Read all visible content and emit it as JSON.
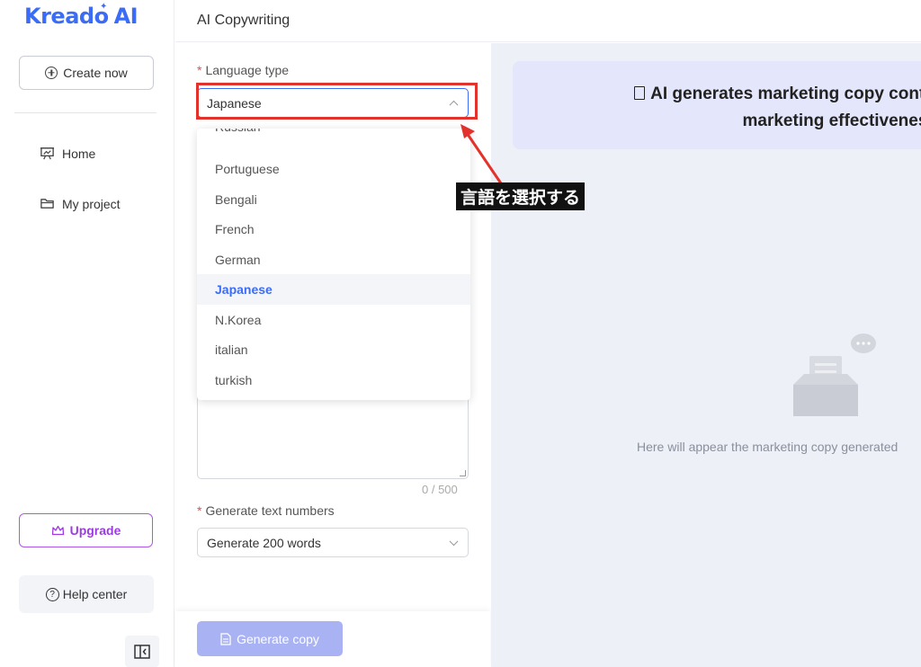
{
  "sidebar": {
    "logo_text": "Kreado",
    "logo_ai": "AI",
    "create_label": "Create now",
    "nav": [
      {
        "label": "Home",
        "icon": "presentation-icon"
      },
      {
        "label": "My project",
        "icon": "folder-icon"
      }
    ],
    "upgrade_label": "Upgrade",
    "help_label": "Help center"
  },
  "header": {
    "title": "AI Copywriting"
  },
  "form": {
    "language_label": "Language type",
    "language_value": "Japanese",
    "generate_numbers_label": "Generate text numbers",
    "generate_numbers_value": "Generate 200 words",
    "counter": "0 / 500",
    "generate_button": "Generate copy"
  },
  "dropdown": {
    "items": [
      "Russian",
      "Portuguese",
      "Bengali",
      "French",
      "German",
      "Japanese",
      "N.Korea",
      "italian",
      "turkish"
    ],
    "selected": "Japanese"
  },
  "preview": {
    "banner_line1": "AI generates marketing copy content to",
    "banner_line2": "marketing effectiveness",
    "empty_text": "Here will appear the marketing copy generated"
  },
  "annotation": {
    "label": "言語を選択する",
    "color": "#e3322c"
  },
  "colors": {
    "accent": "#3b6cf6",
    "upgrade": "#9b3be0",
    "generate_button": "#a9b3f4"
  }
}
